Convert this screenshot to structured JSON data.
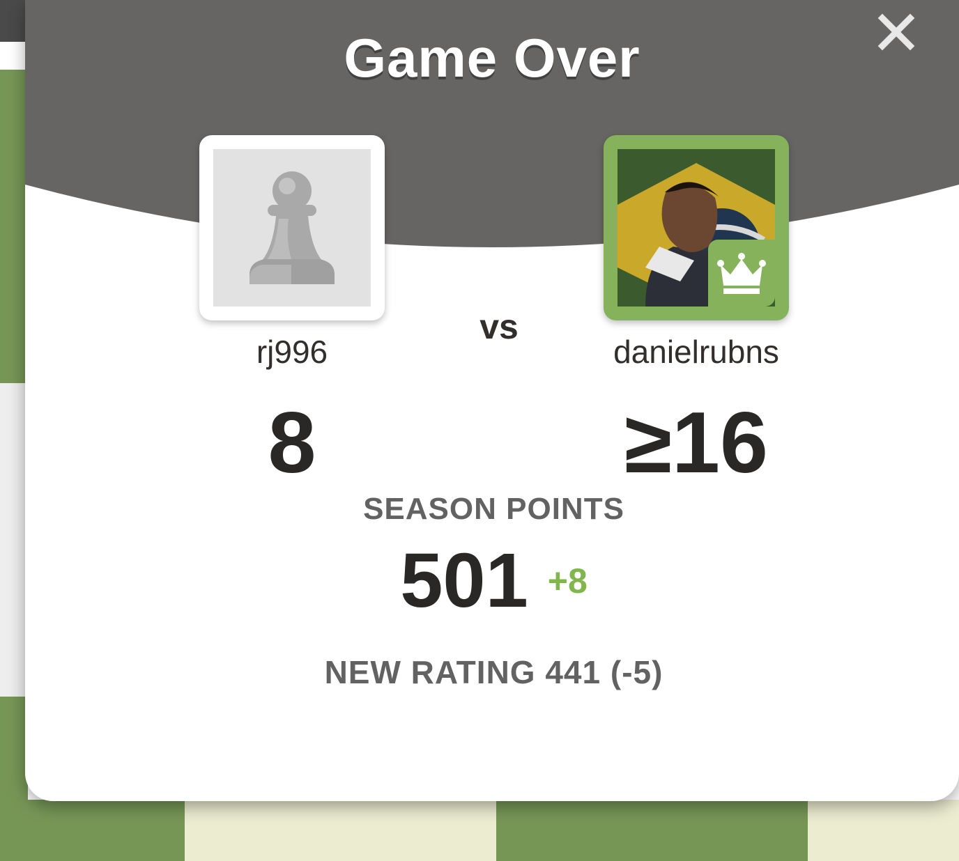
{
  "modal": {
    "title": "Game Over",
    "close_icon": "close-icon"
  },
  "players": {
    "left": {
      "username": "rj996",
      "score": "8",
      "avatar_icon": "pawn-icon"
    },
    "right": {
      "username": "danielrubns",
      "score": "≥16",
      "badge_icon": "crown-icon"
    },
    "vs_label": "vs"
  },
  "season": {
    "label": "SEASON POINTS",
    "value": "501",
    "delta": "+8"
  },
  "rating": {
    "text": "NEW RATING 441 (-5)"
  },
  "colors": {
    "header": "#666564",
    "accent_green": "#81b64c",
    "text_dark": "#2a2826",
    "text_gray": "#626262"
  }
}
